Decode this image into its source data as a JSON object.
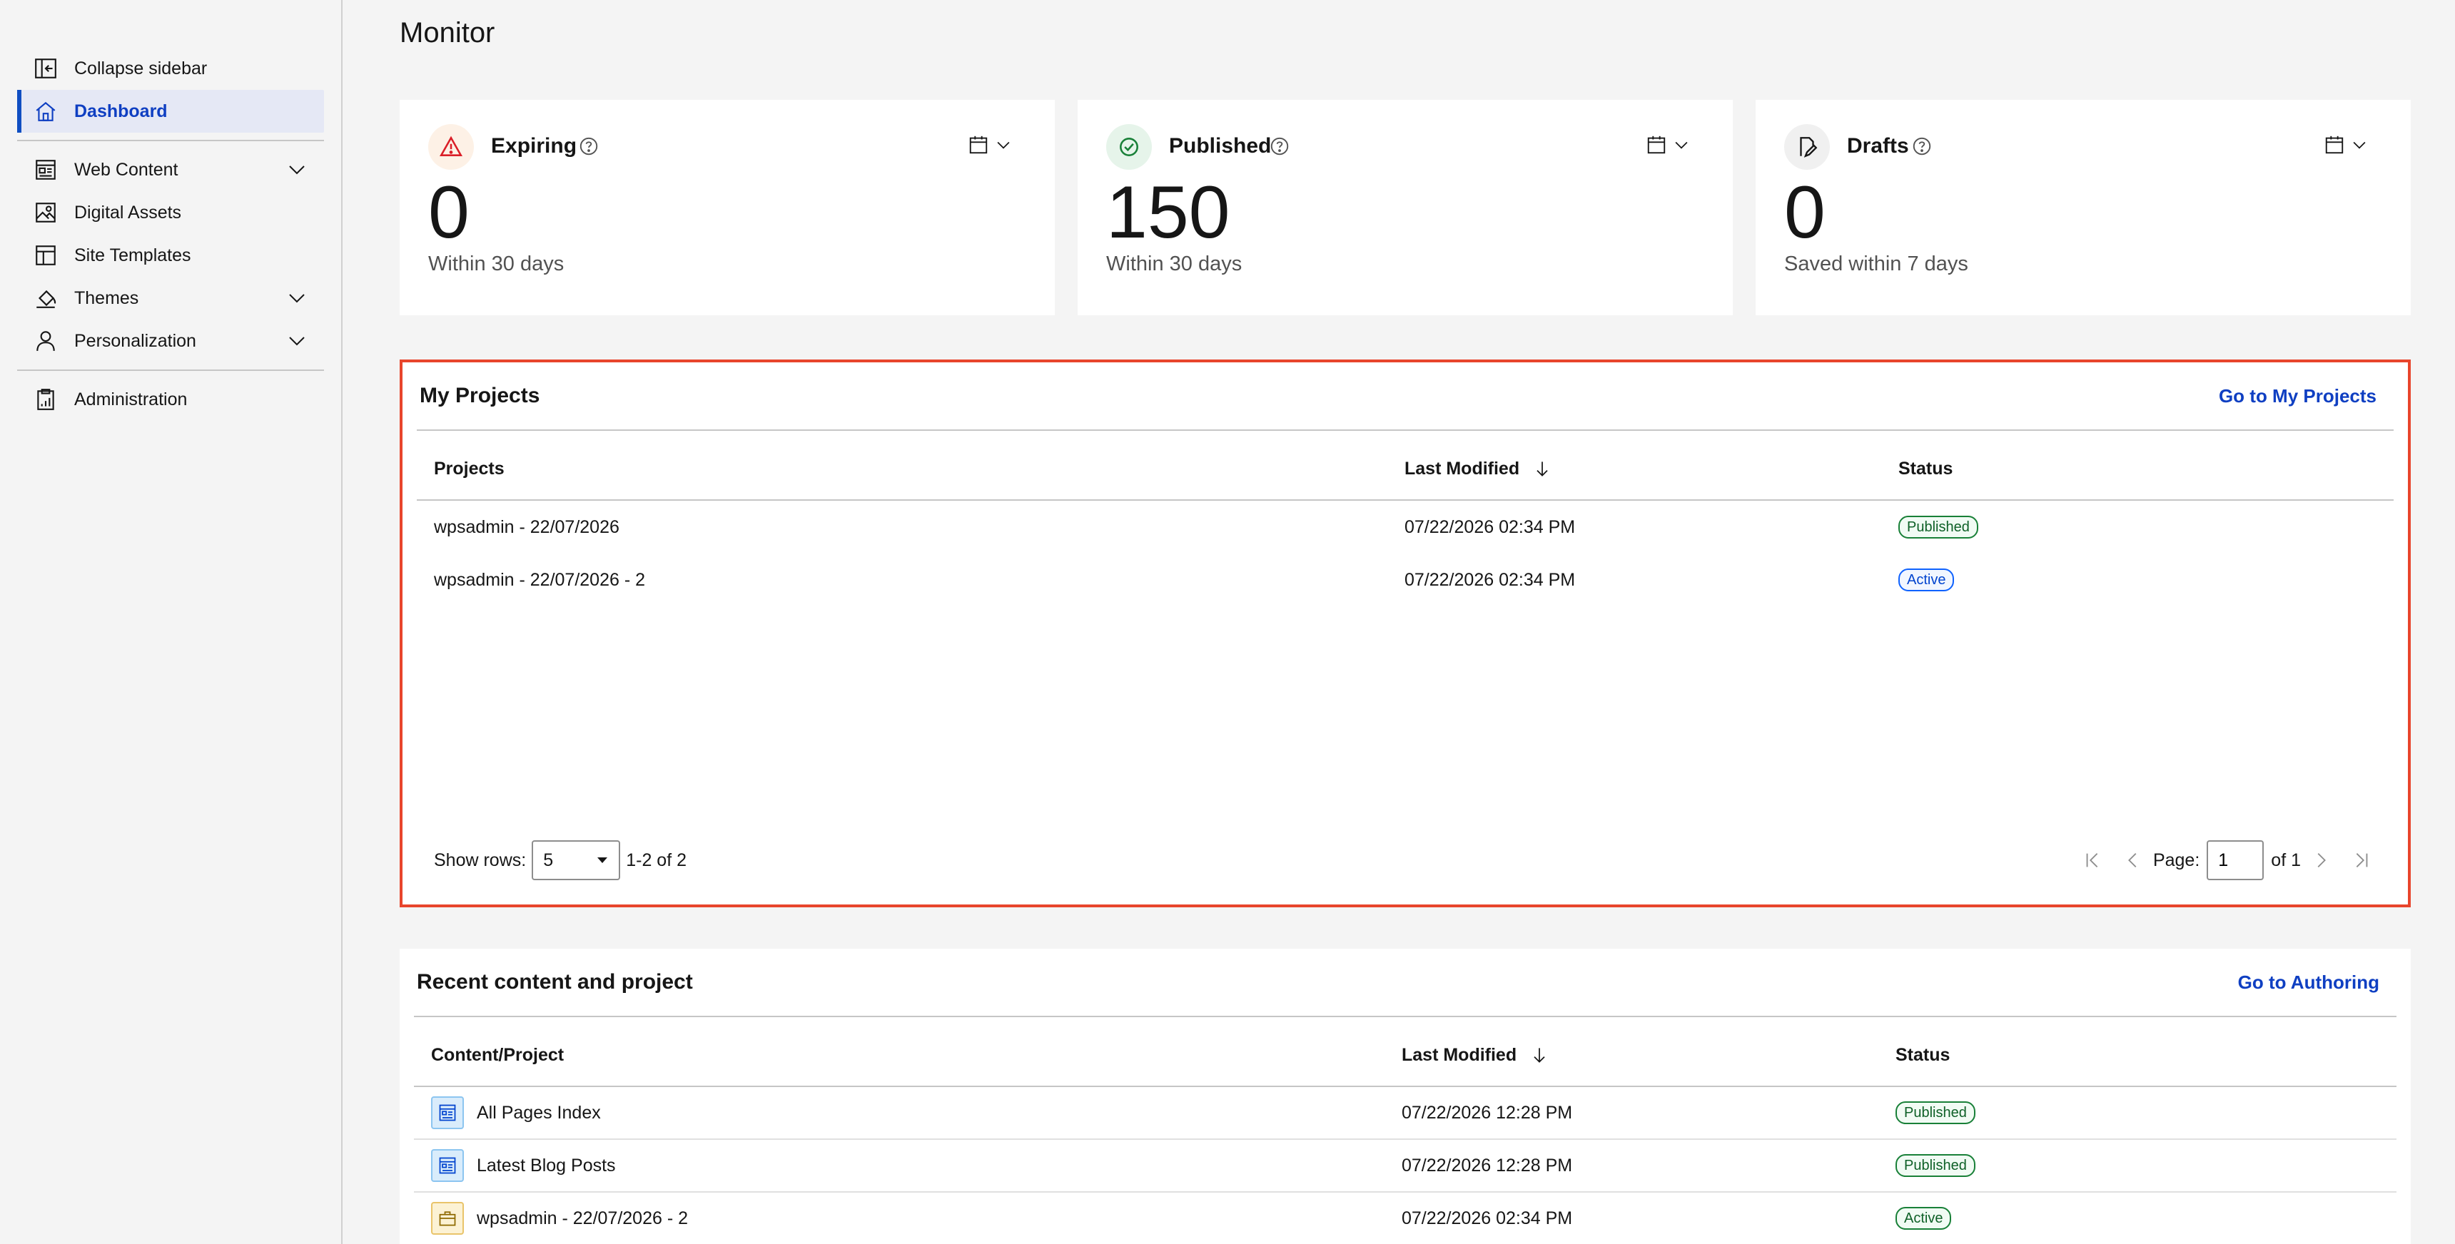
{
  "sidebar": {
    "items": [
      {
        "label": "Collapse sidebar",
        "icon": "collapse-sidebar-icon"
      },
      {
        "label": "Dashboard",
        "icon": "home-icon",
        "active": true
      },
      {
        "label": "Web Content",
        "icon": "web-content-icon",
        "expandable": true
      },
      {
        "label": "Digital Assets",
        "icon": "image-icon"
      },
      {
        "label": "Site Templates",
        "icon": "template-icon"
      },
      {
        "label": "Themes",
        "icon": "paint-bucket-icon",
        "expandable": true
      },
      {
        "label": "Personalization",
        "icon": "user-icon",
        "expandable": true
      },
      {
        "label": "Administration",
        "icon": "clipboard-icon"
      }
    ]
  },
  "header": {
    "title": "Monitor"
  },
  "cards": [
    {
      "title": "Expiring",
      "value": "0",
      "caption": "Within 30 days",
      "icon": "warning-icon",
      "color": "#da1e28"
    },
    {
      "title": "Published",
      "value": "150",
      "caption": "Within 30 days",
      "icon": "checkmark-circle-icon",
      "color": "#198038"
    },
    {
      "title": "Drafts",
      "value": "0",
      "caption": "Saved within 7 days",
      "icon": "draft-edit-icon",
      "color": "#161616"
    }
  ],
  "my_projects": {
    "title": "My Projects",
    "link": "Go to My Projects",
    "columns": [
      "Projects",
      "Last Modified",
      "Status"
    ],
    "rows": [
      {
        "name": "wpsadmin - 22/07/2026",
        "modified": "07/22/2026 02:34 PM",
        "status": "Published"
      },
      {
        "name": "wpsadmin - 22/07/2026 - 2",
        "modified": "07/22/2026 02:34 PM",
        "status": "Active"
      }
    ],
    "pager": {
      "show_rows_label": "Show rows:",
      "rows_value": "5",
      "range": "1-2 of 2",
      "page_label": "Page:",
      "page_value": "1",
      "of_label": "of 1"
    }
  },
  "recent": {
    "title": "Recent content and project",
    "link": "Go to Authoring",
    "columns": [
      "Content/Project",
      "Last Modified",
      "Status"
    ],
    "rows": [
      {
        "name": "All Pages Index",
        "modified": "07/22/2026 12:28 PM",
        "status": "Published",
        "icon": "content-icon"
      },
      {
        "name": "Latest Blog Posts",
        "modified": "07/22/2026 12:28 PM",
        "status": "Published",
        "icon": "content-icon"
      },
      {
        "name": "wpsadmin - 22/07/2026 - 2",
        "modified": "07/22/2026 02:34 PM",
        "status": "Active",
        "icon": "briefcase-icon"
      }
    ]
  },
  "colors": {
    "accent": "#0f3fc2",
    "highlight_border": "#e8452c",
    "published": "#198038",
    "active": "#0f62fe"
  }
}
